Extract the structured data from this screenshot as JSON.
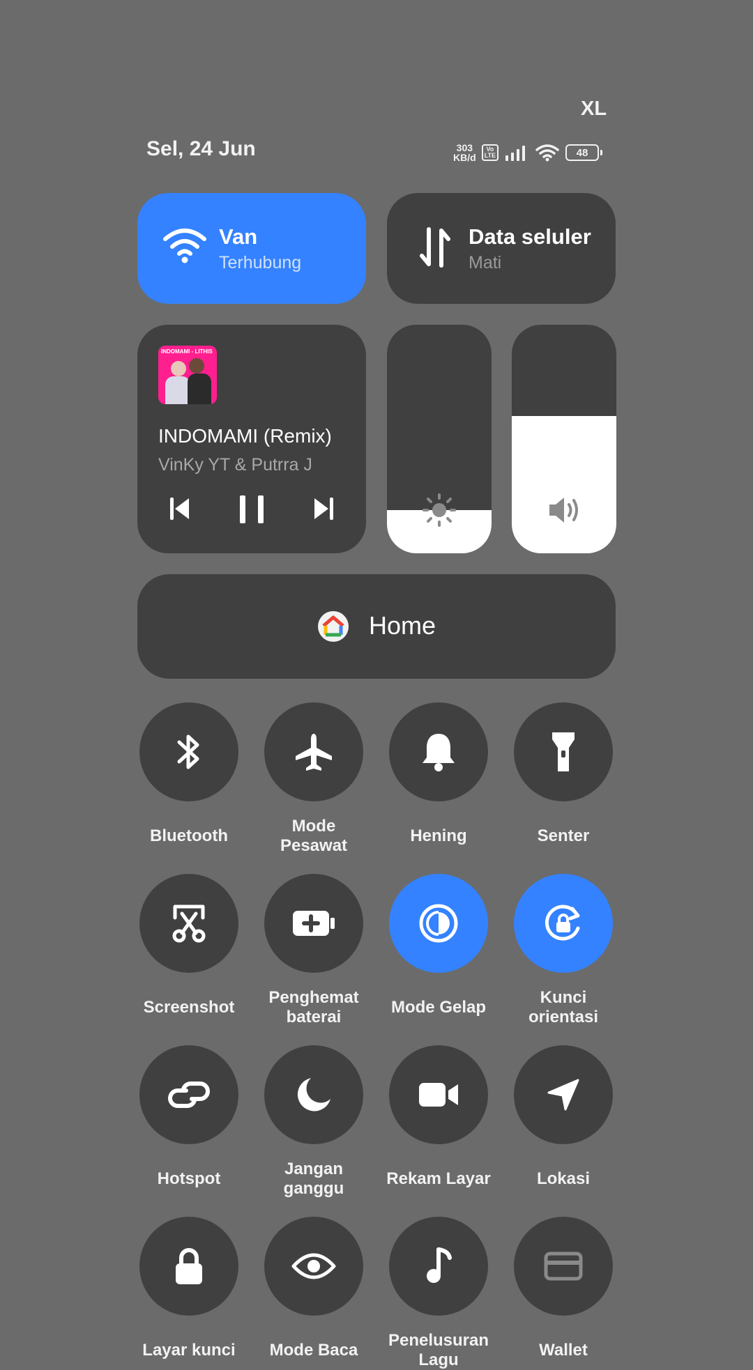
{
  "status_bar": {
    "carrier": "XL",
    "date": "Sel, 24 Jun",
    "speed_value": "303",
    "speed_unit": "KB/d",
    "volte_top": "Vo",
    "volte_bottom": "LTE",
    "battery": "48"
  },
  "wifi_tile": {
    "title": "Van",
    "subtitle": "Terhubung",
    "active": true
  },
  "data_tile": {
    "title": "Data seluler",
    "subtitle": "Mati",
    "active": false
  },
  "media": {
    "album_art_text": "INDOMAMI - LITHIS",
    "title": "INDOMAMI (Remix)",
    "artist": "VinKy YT & Putrra J",
    "state": "playing"
  },
  "brightness": {
    "level": 0.19
  },
  "volume": {
    "level": 0.6
  },
  "home_button": {
    "label": "Home"
  },
  "toggles": [
    {
      "label": "Bluetooth",
      "icon": "bluetooth-icon",
      "active": false
    },
    {
      "label": "Mode\nPesawat",
      "icon": "airplane-icon",
      "active": false
    },
    {
      "label": "Hening",
      "icon": "bell-icon",
      "active": false
    },
    {
      "label": "Senter",
      "icon": "flashlight-icon",
      "active": false
    },
    {
      "label": "Screenshot",
      "icon": "scissors-icon",
      "active": false
    },
    {
      "label": "Penghemat\nbaterai",
      "icon": "battery-plus-icon",
      "active": false
    },
    {
      "label": "Mode Gelap",
      "icon": "dark-mode-icon",
      "active": true
    },
    {
      "label": "Kunci\norientasi",
      "icon": "rotation-lock-icon",
      "active": true
    },
    {
      "label": "Hotspot",
      "icon": "link-icon",
      "active": false
    },
    {
      "label": "Jangan\nganggu",
      "icon": "moon-icon",
      "active": false
    },
    {
      "label": "Rekam Layar",
      "icon": "video-camera-icon",
      "active": false
    },
    {
      "label": "Lokasi",
      "icon": "location-arrow-icon",
      "active": false
    },
    {
      "label": "Layar kunci",
      "icon": "lock-icon",
      "active": false
    },
    {
      "label": "Mode Baca",
      "icon": "eye-icon",
      "active": false
    },
    {
      "label": "Penelusuran\nLagu",
      "icon": "music-note-icon",
      "active": false
    },
    {
      "label": "Wallet",
      "icon": "wallet-icon",
      "active": false
    }
  ]
}
